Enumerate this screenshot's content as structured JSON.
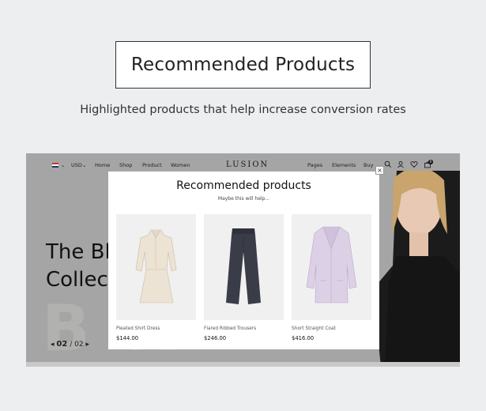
{
  "header": {
    "title": "Recommended Products",
    "subtitle": "Highlighted products that help increase conversion rates"
  },
  "site": {
    "logo": "LUSION",
    "currency": "USD",
    "nav_left": [
      "Home",
      "Shop",
      "Product",
      "Women"
    ],
    "nav_right": [
      "Pages",
      "Elements",
      "Buy"
    ],
    "cart_count": "0",
    "hero_text_line1": "The Bla",
    "hero_text_line2": "Collec",
    "bg_letters": "B  K",
    "pager_current": "02",
    "pager_sep": "/",
    "pager_total": "02"
  },
  "modal": {
    "title": "Recommended products",
    "subtitle": "Maybe this will help...",
    "close": "×",
    "products": [
      {
        "name": "Pleated Shirt Dress",
        "price": "$144.00"
      },
      {
        "name": "Flared Ribbed Trousers",
        "price": "$246.00"
      },
      {
        "name": "Short Straight Coat",
        "price": "$416.00"
      }
    ]
  },
  "colors": {
    "page_bg": "#eceef0",
    "hero_bg": "#a4a5a4",
    "modal_bg": "#ffffff"
  },
  "icons": [
    "flag-uk-icon",
    "chevron-down-icon",
    "search-icon",
    "user-icon",
    "heart-icon",
    "cart-icon",
    "close-icon",
    "arrow-left-icon",
    "arrow-right-icon"
  ]
}
